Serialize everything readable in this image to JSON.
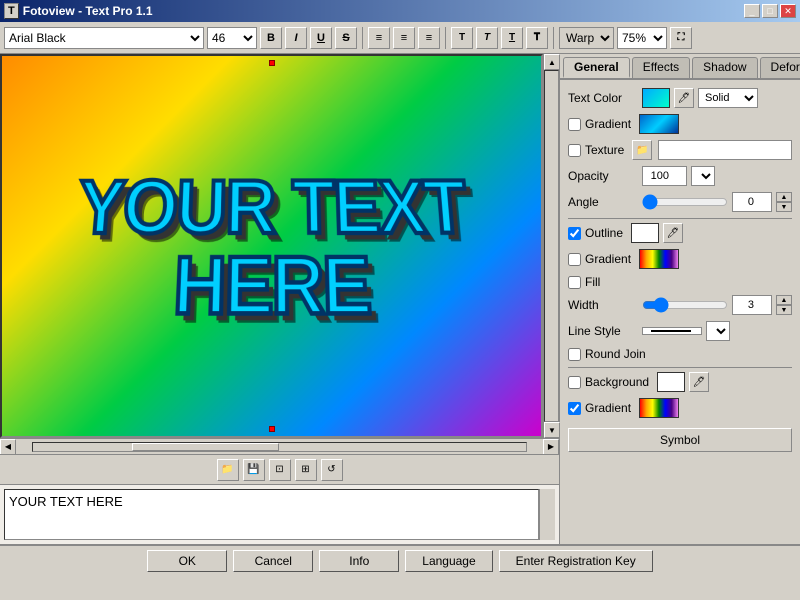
{
  "window": {
    "title": "Fotoview - Text Pro 1.1",
    "icon": "T"
  },
  "toolbar": {
    "font": "Arial Black",
    "font_size": "46",
    "bold": "B",
    "italic": "I",
    "underline": "U",
    "strikethrough": "S",
    "align_left": "≡",
    "align_center": "≡",
    "align_right": "≡",
    "text_btn1": "T",
    "text_btn2": "T",
    "text_btn3": "T",
    "text_btn4": "T",
    "warp_label": "Warp",
    "zoom": "75%",
    "fullscreen": "⛶"
  },
  "tabs": {
    "general": "General",
    "effects": "Effects",
    "shadow": "Shadow",
    "deform": "Deform"
  },
  "panel": {
    "text_color_label": "Text Color",
    "text_color_type": "Solid",
    "gradient_label": "Gradient",
    "texture_label": "Texture",
    "opacity_label": "Opacity",
    "opacity_value": "100",
    "angle_label": "Angle",
    "angle_value": "0",
    "outline_label": "Outline",
    "gradient_label2": "Gradient",
    "fill_label": "Fill",
    "width_label": "Width",
    "width_value": "3",
    "line_style_label": "Line Style",
    "round_join_label": "Round Join",
    "background_label": "Background",
    "gradient_label3": "Gradient",
    "symbol_btn": "Symbol"
  },
  "canvas": {
    "text": "YOUR TEXT HERE"
  },
  "bottom_buttons": {
    "ok": "OK",
    "cancel": "Cancel",
    "info": "Info",
    "language": "Language",
    "registration": "Enter Registration Key"
  }
}
